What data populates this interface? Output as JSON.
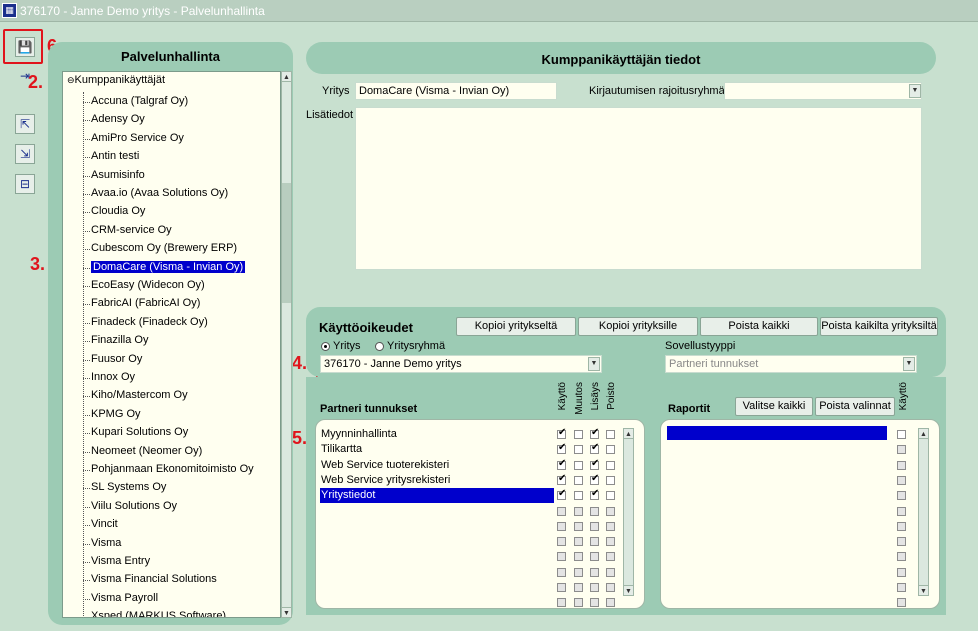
{
  "window": {
    "title": "376170 - Janne Demo yritys - Palvelunhallinta"
  },
  "callouts": {
    "n2": "2.",
    "n3": "3.",
    "n4": "4.",
    "n5": "5.",
    "n6": "6."
  },
  "tree": {
    "title": "Palvelunhallinta",
    "root": "Kumppanikäyttäjät",
    "items": [
      "Accuna (Talgraf Oy)",
      "Adensy Oy",
      "AmiPro Service Oy",
      "Antin testi",
      "Asumisinfo",
      "Avaa.io (Avaa Solutions Oy)",
      "Cloudia Oy",
      "CRM-service Oy",
      "Cubescom Oy (Brewery ERP)",
      "DomaCare (Visma - Invian Oy)",
      "EcoEasy (Widecon Oy)",
      "FabricAI (FabricAI Oy)",
      "Finadeck (Finadeck Oy)",
      "Finazilla Oy",
      "Fuusor Oy",
      "Innox Oy",
      "Kiho/Mastercom Oy",
      "KPMG Oy",
      "Kupari Solutions Oy",
      "Neomeet (Neomer Oy)",
      "Pohjanmaan Ekonomitoimisto Oy",
      "SL Systems Oy",
      "Viilu Solutions Oy",
      "Vincit",
      "Visma",
      "Visma Entry",
      "Visma Financial Solutions",
      "Visma Payroll",
      "Xsped (MARKUS Software)"
    ],
    "selected_index": 9
  },
  "info": {
    "header": "Kumppanikäyttäjän tiedot",
    "company_label": "Yritys",
    "company_value": "DomaCare (Visma - Invian Oy)",
    "login_group_label": "Kirjautumisen rajoitusryhmä",
    "login_group_value": "",
    "extra_label": "Lisätiedot",
    "extra_value": ""
  },
  "rights": {
    "title": "Käyttöoikeudet",
    "buttons": {
      "copy_from": "Kopioi yritykseltä",
      "copy_to": "Kopioi yrityksille",
      "remove_all": "Poista kaikki",
      "remove_all_companies": "Poista kaikilta yrityksiltä"
    },
    "radio_company": "Yritys",
    "radio_group": "Yritysryhmä",
    "company_select": "376170 - Janne Demo yritys",
    "app_type_label": "Sovellustyyppi",
    "app_type_value": "Partneri tunnukset"
  },
  "partners": {
    "title": "Partneri tunnukset",
    "columns": [
      "Käyttö",
      "Muutos",
      "Lisäys",
      "Poisto"
    ],
    "rows": [
      {
        "name": "Myynninhallinta",
        "checks": [
          true,
          false,
          true,
          false
        ]
      },
      {
        "name": "Tilikartta",
        "checks": [
          true,
          false,
          true,
          false
        ]
      },
      {
        "name": "Web Service tuoterekisteri",
        "checks": [
          true,
          false,
          true,
          false
        ]
      },
      {
        "name": "Web Service yritysrekisteri",
        "checks": [
          true,
          false,
          true,
          false
        ]
      },
      {
        "name": "Yritystiedot",
        "checks": [
          true,
          false,
          true,
          false
        ]
      }
    ]
  },
  "reports": {
    "title": "Raportit",
    "select_all": "Valitse kaikki",
    "remove_selected": "Poista valinnat",
    "column": "Käyttö"
  }
}
